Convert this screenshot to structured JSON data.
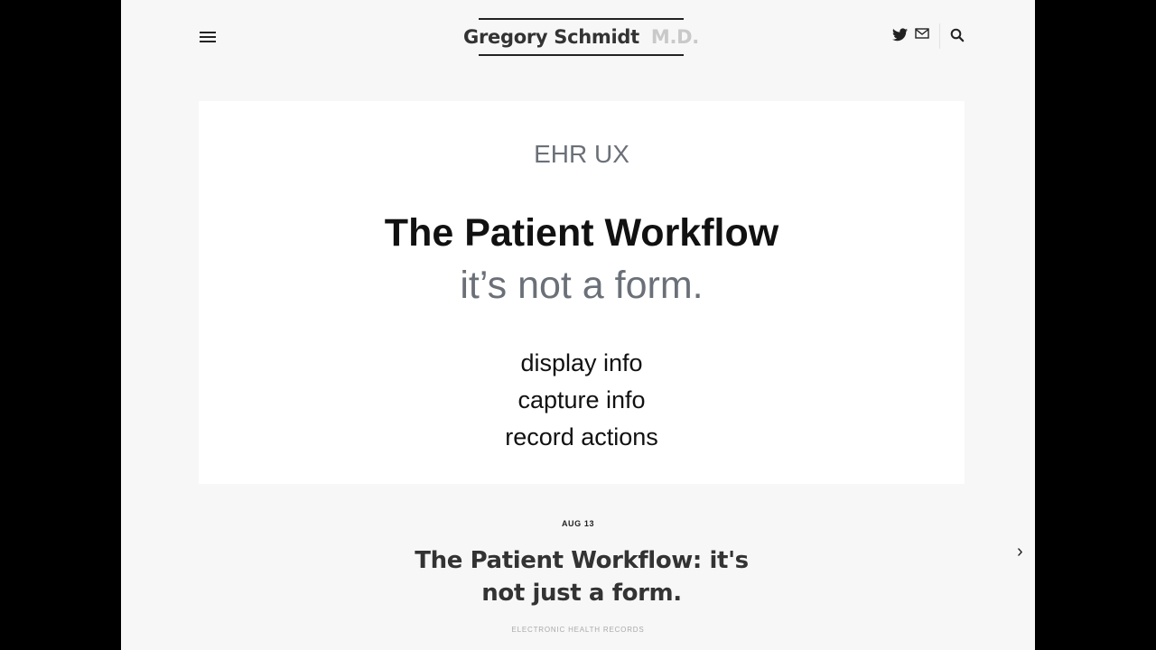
{
  "header": {
    "site_name": "Gregory Schmidt",
    "site_suffix": "M.D.",
    "icons": [
      "menu-icon",
      "twitter-icon",
      "mail-icon",
      "search-icon"
    ]
  },
  "hero": {
    "category": "EHR UX",
    "title": "The Patient Workflow",
    "subtitle": "it’s not a form.",
    "items": [
      "display info",
      "capture info",
      "record actions"
    ]
  },
  "post": {
    "date": "AUG 13",
    "title": "The Patient Workflow: it's not just a form.",
    "category": "ELECTRONIC HEALTH RECORDS"
  },
  "nav": {
    "next_glyph": "›"
  },
  "colors": {
    "page_bg": "#f7f7f7",
    "card_bg": "#ffffff",
    "accent_gray": "#6b7078",
    "text_dark": "#111111",
    "suffix_gray": "#c9c9c9"
  }
}
